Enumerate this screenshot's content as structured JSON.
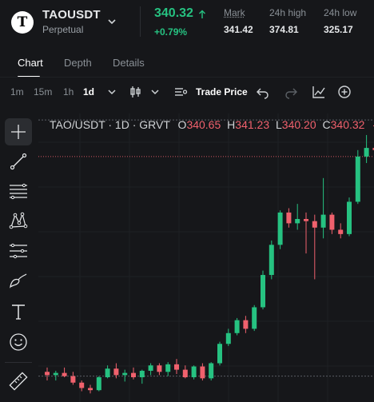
{
  "header": {
    "logo_letter": "T",
    "symbol": "TAOUSDT",
    "contract_type": "Perpetual",
    "price": "340.32",
    "change_pct": "+0.79%",
    "mark_label": "Mark",
    "mark_value": "341.42",
    "high_label": "24h high",
    "high_value": "374.81",
    "low_label": "24h low",
    "low_value": "325.17",
    "up_color": "#26c281",
    "down_color": "#f0616d"
  },
  "tabs": [
    "Chart",
    "Depth",
    "Details"
  ],
  "toolbar": {
    "timeframes": [
      "1m",
      "15m",
      "1h",
      "1d"
    ],
    "active_timeframe": "1d",
    "price_source": "Trade Price",
    "icons": [
      "candlestick-icon",
      "chevron-down-icon",
      "indicators-icon",
      "undo-icon",
      "redo-icon",
      "line-chart-icon",
      "add-icon"
    ]
  },
  "drawing_tools": [
    "crosshair-icon",
    "trend-line-icon",
    "fib-lines-icon",
    "pattern-icon",
    "parallel-channel-icon",
    "brush-icon",
    "text-icon",
    "emoji-icon",
    "ruler-icon"
  ],
  "legend": {
    "title": "TAO/USDT · 1D · GRVT",
    "o_label": "O",
    "o_value": "340.65",
    "h_label": "H",
    "h_value": "341.23",
    "l_label": "L",
    "l_value": "340.20",
    "c_label": "C",
    "c_value": "340.32",
    "tail": "-0"
  },
  "chart_data": {
    "type": "candlestick",
    "candles": [
      [
        1,
        272.0,
        274.0,
        268.0,
        270.5
      ],
      [
        2,
        270.5,
        272.5,
        268.0,
        271.5
      ],
      [
        3,
        271.5,
        274.0,
        269.5,
        270.0
      ],
      [
        4,
        270.0,
        272.0,
        266.0,
        267.0
      ],
      [
        5,
        267.0,
        268.0,
        263.0,
        264.5
      ],
      [
        6,
        264.5,
        266.0,
        262.0,
        263.5
      ],
      [
        7,
        263.5,
        270.0,
        263.0,
        269.5
      ],
      [
        8,
        269.5,
        275.0,
        269.0,
        273.5
      ],
      [
        9,
        273.5,
        276.0,
        269.0,
        270.5
      ],
      [
        10,
        270.5,
        273.0,
        267.5,
        271.5
      ],
      [
        11,
        271.5,
        274.0,
        268.5,
        269.5
      ],
      [
        12,
        269.5,
        273.0,
        266.5,
        272.5
      ],
      [
        13,
        272.5,
        276.0,
        270.5,
        275.0
      ],
      [
        14,
        275.0,
        276.0,
        270.5,
        272.0
      ],
      [
        15,
        272.0,
        276.5,
        270.0,
        275.5
      ],
      [
        16,
        275.5,
        278.0,
        271.0,
        273.0
      ],
      [
        17,
        273.0,
        275.0,
        269.0,
        269.5
      ],
      [
        18,
        269.5,
        275.0,
        268.5,
        274.5
      ],
      [
        19,
        274.5,
        276.0,
        268.0,
        269.0
      ],
      [
        20,
        269.0,
        276.5,
        268.0,
        276.0
      ],
      [
        21,
        276.0,
        286.0,
        275.0,
        285.0
      ],
      [
        22,
        285.0,
        292.0,
        284.0,
        290.0
      ],
      [
        23,
        290.0,
        297.0,
        289.0,
        296.0
      ],
      [
        24,
        296.0,
        298.0,
        290.0,
        292.0
      ],
      [
        25,
        292.0,
        303.0,
        291.0,
        302.0
      ],
      [
        26,
        302.0,
        319.0,
        301.0,
        317.0
      ],
      [
        27,
        317.0,
        333.0,
        315.0,
        331.0
      ],
      [
        28,
        331.0,
        347.0,
        329.0,
        346.0
      ],
      [
        29,
        346.0,
        348.0,
        339.0,
        341.0
      ],
      [
        30,
        341.0,
        350.0,
        338.0,
        343.0
      ],
      [
        31,
        343.0,
        346.0,
        327.0,
        342.0
      ],
      [
        32,
        342.0,
        345.0,
        315.0,
        339.0
      ],
      [
        33,
        339.0,
        362.0,
        334.0,
        345.0
      ],
      [
        34,
        345.0,
        346.0,
        336.0,
        338.0
      ],
      [
        35,
        338.0,
        341.0,
        334.0,
        336.0
      ],
      [
        36,
        336.0,
        353.0,
        335.0,
        351.0
      ],
      [
        37,
        351.0,
        375.0,
        350.0,
        372.0
      ],
      [
        38,
        372.0,
        382.0,
        369.0,
        376.0
      ],
      [
        39,
        376.0,
        377.0,
        374.0,
        375.0
      ]
    ],
    "last_price_line": 372.0,
    "dashed_levels": [
      389.0,
      270.0
    ],
    "ylim": [
      258,
      392
    ],
    "grid": true
  }
}
